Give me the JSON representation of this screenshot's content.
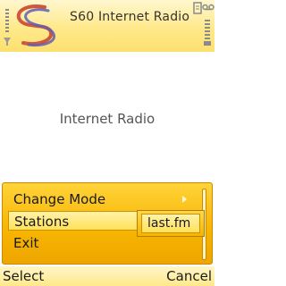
{
  "status": {
    "title": "S60 Internet Radio",
    "icons": [
      "signal-icon",
      "battery-icon",
      "message-icon",
      "voicemail-icon"
    ]
  },
  "main": {
    "heading": "Internet Radio"
  },
  "menu": {
    "items": [
      {
        "label": "Change Mode",
        "has_submenu": true
      },
      {
        "label": "Stations",
        "selected": true
      },
      {
        "label": "Exit"
      }
    ],
    "submenu": {
      "items": [
        {
          "label": "last.fm",
          "selected": true
        }
      ]
    }
  },
  "softkeys": {
    "left": "Select",
    "right": "Cancel"
  },
  "colors": {
    "menu_bg": "#f7b400",
    "highlight": "#ffe15a",
    "status_bg": "#ffe98a"
  }
}
